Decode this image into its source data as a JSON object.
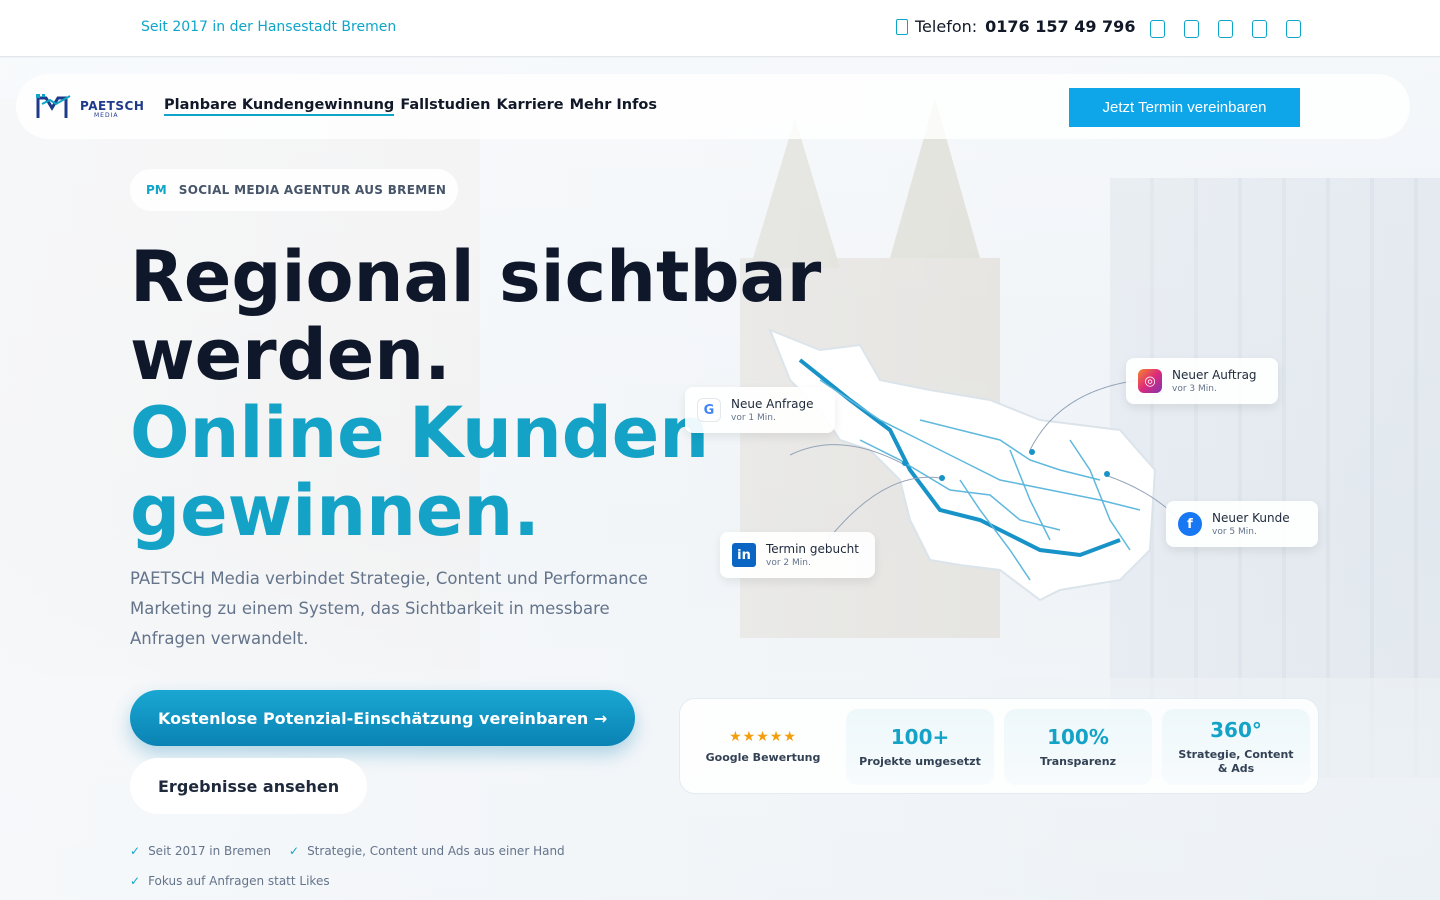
{
  "topbar": {
    "since": "Seit 2017 in der Hansestadt Bremen",
    "phone_label": "Telefon:",
    "phone_number": "0176 157 49 796",
    "social_icons": [
      "facebook-icon",
      "instagram-icon",
      "linkedin-icon",
      "youtube-icon",
      "tiktok-icon"
    ]
  },
  "nav": {
    "logo_text": "PAETSCH",
    "logo_sub": "MEDIA",
    "links": [
      "Planbare Kundengewinnung",
      "Fallstudien",
      "Karriere",
      "Mehr Infos"
    ],
    "cta": "Jetzt Termin vereinbaren"
  },
  "hero": {
    "badge_pm": "PM",
    "badge_text": "SOCIAL MEDIA AGENTUR AUS BREMEN",
    "headline_line1": "Regional sichtbar",
    "headline_line2": "werden.",
    "headline_line3": "Online Kunden",
    "headline_line4": "gewinnen.",
    "lead": "PAETSCH Media verbindet Strategie, Content und Performance Marketing zu einem System, das Sichtbarkeit in messbare Anfragen verwandelt.",
    "primary_button": "Kostenlose Potenzial-Einschätzung vereinbaren →",
    "secondary_button": "Ergebnisse ansehen",
    "checks": [
      "Seit 2017 in Bremen",
      "Strategie, Content und Ads aus einer Hand",
      "Fokus auf Anfragen statt Likes"
    ]
  },
  "notifications": [
    {
      "title": "Neue Anfrage",
      "time": "vor 1 Min.",
      "icon": "google-icon",
      "color": "#ffffff"
    },
    {
      "title": "Neuer Auftrag",
      "time": "vor 3 Min.",
      "icon": "instagram-icon",
      "color": "#d62976"
    },
    {
      "title": "Neuer Kunde",
      "time": "vor 5 Min.",
      "icon": "facebook-icon",
      "color": "#1877f2"
    },
    {
      "title": "Termin gebucht",
      "time": "vor 2 Min.",
      "icon": "linkedin-icon",
      "color": "#0a66c2"
    }
  ],
  "stats": [
    {
      "value": "★★★★★",
      "label": "Google Bewertung"
    },
    {
      "value": "100+",
      "label": "Projekte umgesetzt"
    },
    {
      "value": "100%",
      "label": "Transparenz"
    },
    {
      "value": "360°",
      "label": "Strategie, Content & Ads"
    }
  ],
  "colors": {
    "accent": "#14a3c7",
    "primary_button": "#0ea5e9",
    "headline": "#0f172a"
  }
}
